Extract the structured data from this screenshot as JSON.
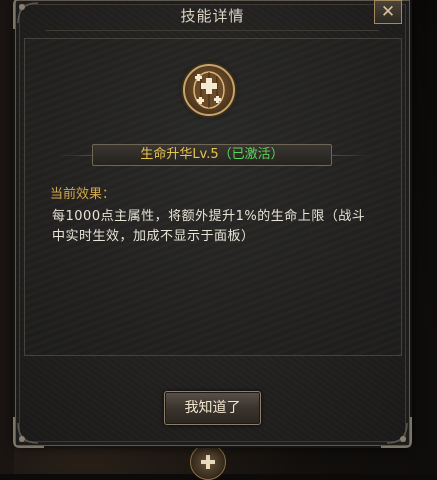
{
  "dialog": {
    "title": "技能详情",
    "close_label": "✕"
  },
  "skill": {
    "icon": "medical-cross-shield-icon",
    "name": "生命升华Lv.5",
    "status": "（已激活）"
  },
  "effect": {
    "label": "当前效果：",
    "text": "每1000点主属性，将额外提升1%的生命上限（战斗中实时生效，加成不显示于面板）"
  },
  "buttons": {
    "ok_label": "我知道了"
  },
  "colors": {
    "skill_name": "#e6c24f",
    "status_active": "#5fd35f",
    "effect_label": "#d4a84a",
    "frame_gold": "#c7a46a"
  }
}
